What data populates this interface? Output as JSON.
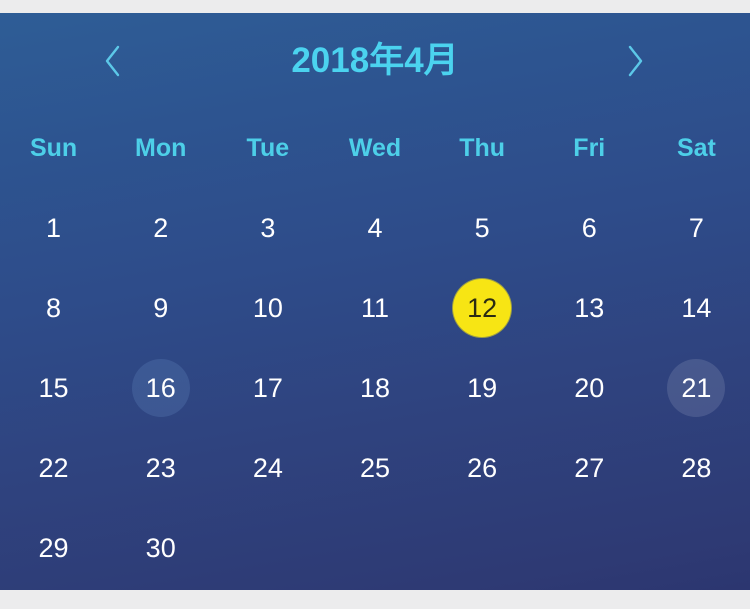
{
  "header": {
    "title": "2018年4月",
    "prev_icon": "chevron-left-icon",
    "next_icon": "chevron-right-icon",
    "title_color": "#4bd3ef"
  },
  "weekdays": [
    {
      "label": "Sun"
    },
    {
      "label": "Mon"
    },
    {
      "label": "Tue"
    },
    {
      "label": "Wed"
    },
    {
      "label": "Thu"
    },
    {
      "label": "Fri"
    },
    {
      "label": "Sat"
    }
  ],
  "weeks": [
    [
      {
        "day": "1",
        "state": "normal"
      },
      {
        "day": "2",
        "state": "normal"
      },
      {
        "day": "3",
        "state": "normal"
      },
      {
        "day": "4",
        "state": "normal"
      },
      {
        "day": "5",
        "state": "normal"
      },
      {
        "day": "6",
        "state": "normal"
      },
      {
        "day": "7",
        "state": "normal"
      }
    ],
    [
      {
        "day": "8",
        "state": "normal"
      },
      {
        "day": "9",
        "state": "normal"
      },
      {
        "day": "10",
        "state": "normal"
      },
      {
        "day": "11",
        "state": "normal"
      },
      {
        "day": "12",
        "state": "selected"
      },
      {
        "day": "13",
        "state": "normal"
      },
      {
        "day": "14",
        "state": "normal"
      }
    ],
    [
      {
        "day": "15",
        "state": "normal"
      },
      {
        "day": "16",
        "state": "marked-blue"
      },
      {
        "day": "17",
        "state": "normal"
      },
      {
        "day": "18",
        "state": "normal"
      },
      {
        "day": "19",
        "state": "normal"
      },
      {
        "day": "20",
        "state": "normal"
      },
      {
        "day": "21",
        "state": "marked-grey"
      }
    ],
    [
      {
        "day": "22",
        "state": "normal"
      },
      {
        "day": "23",
        "state": "normal"
      },
      {
        "day": "24",
        "state": "normal"
      },
      {
        "day": "25",
        "state": "normal"
      },
      {
        "day": "26",
        "state": "normal"
      },
      {
        "day": "27",
        "state": "normal"
      },
      {
        "day": "28",
        "state": "normal"
      }
    ],
    [
      {
        "day": "29",
        "state": "normal"
      },
      {
        "day": "30",
        "state": "normal"
      },
      {
        "day": "",
        "state": "empty"
      },
      {
        "day": "",
        "state": "empty"
      },
      {
        "day": "",
        "state": "empty"
      },
      {
        "day": "",
        "state": "empty"
      },
      {
        "day": "",
        "state": "empty"
      }
    ]
  ],
  "colors": {
    "background_top": "#2e5d96",
    "background_bottom": "#2e3a74",
    "accent_cyan": "#4dcfe8",
    "selected_day_bg": "#f7e514",
    "selected_day_text": "#2b2b13",
    "day_text": "#ffffff",
    "page_strip": "#ececed"
  }
}
